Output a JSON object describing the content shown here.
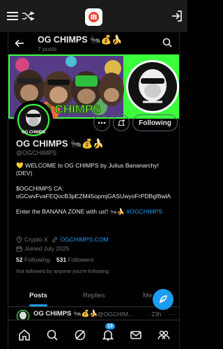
{
  "app_bar": {
    "menu_icon": "hamburger-icon",
    "shuffle_icon": "shuffle-icon",
    "app_icon": "bookmark-library-icon",
    "signin_icon": "sign-in-icon"
  },
  "header": {
    "title": "OG CHIMPS 🐜💰🍌",
    "subtitle": "7 posts"
  },
  "banner": {
    "text": "OG CHIMPS",
    "accent": "#3cff3c"
  },
  "avatar": {
    "text": "OG CHIMPS"
  },
  "actions": {
    "more_label": "···",
    "follow_label": "Following"
  },
  "profile": {
    "name": "OG CHIMPS 🐜💰🍌",
    "handle": "@OGCHIMPS",
    "bio_line1": "💛 WELCOME to OG CHIMPS by Julius Bananarchy!",
    "bio_line2": "(DEV)",
    "ca_line1": "$OGCHIMPS CA:",
    "ca_line2": "oGCwvFvaFEQocB3pEZM45opmjGASUwyoFrPDBgf6wlA",
    "cta_text": "Enter the BANANA ZONE with us!! 🐜🍌 ",
    "cta_hashtag": "#OGCHIMPS",
    "category": "Crypto X",
    "website": "OGCHIMPS.COM",
    "joined": "Joined July 2025",
    "following_count": "52",
    "following_label": "Following",
    "followers_count": "531",
    "followers_label": "Followers",
    "not_followed": "Not followed by anyone you're following"
  },
  "tabs": {
    "posts": "Posts",
    "replies": "Replies",
    "media": "Me"
  },
  "post": {
    "name": "OG CHIMPS 🐜💰🍌",
    "handle": "@OGCHIM...",
    "time": "· 23h",
    "more": "···"
  },
  "bottom_nav": {
    "notifications_badge": "13"
  },
  "colors": {
    "accent": "#1d9bf0",
    "muted": "#71767b"
  }
}
